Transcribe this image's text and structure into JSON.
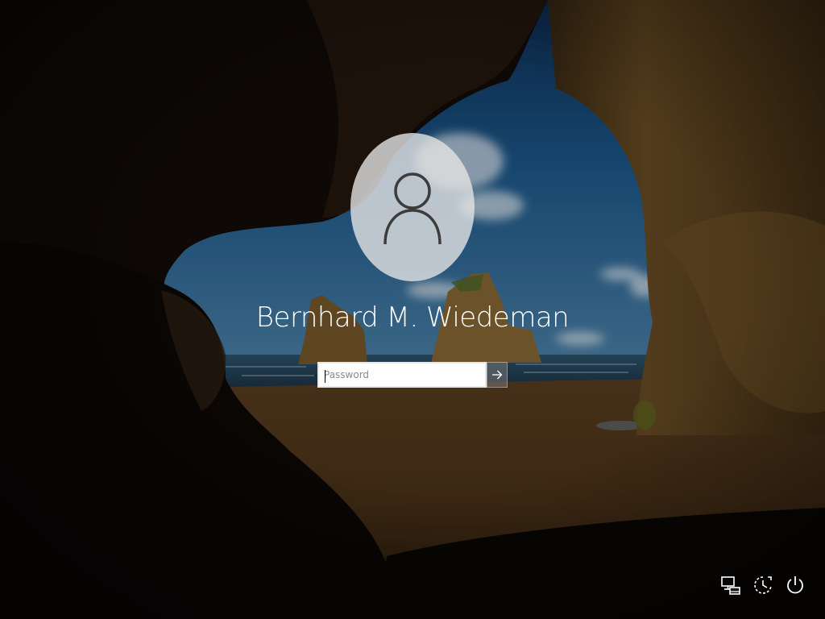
{
  "user": {
    "display_name": "Bernhard M. Wiedeman",
    "avatar_icon": "user-silhouette-icon"
  },
  "login": {
    "password_placeholder": "Password",
    "password_value": "",
    "submit_icon": "arrow-right-icon"
  },
  "corner_buttons": [
    {
      "name": "network",
      "icon": "network-icon"
    },
    {
      "name": "ease-of-access",
      "icon": "ease-of-access-icon"
    },
    {
      "name": "power",
      "icon": "power-icon"
    }
  ],
  "colors": {
    "text": "#ffffff",
    "avatar_bg": "#e4e4e4",
    "input_bg": "#ffffff",
    "submit_bg": "#787878"
  }
}
